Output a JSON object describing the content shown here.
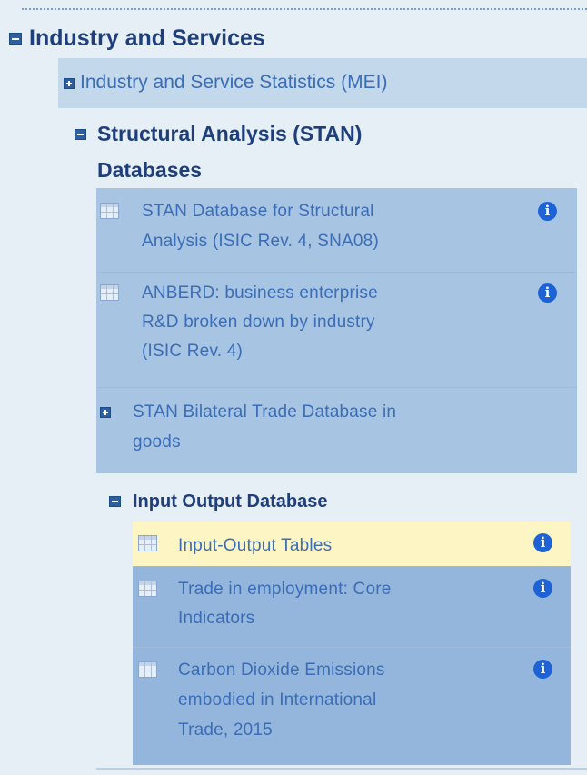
{
  "tree": {
    "root": {
      "label": "Industry and Services"
    },
    "mei": {
      "label": "Industry and Service Statistics (MEI)"
    },
    "stan": {
      "label_line1": "Structural Analysis (STAN)",
      "label_line2": "Databases",
      "items": [
        {
          "line1": "STAN Database for Structural",
          "line2": "Analysis (ISIC Rev. 4, SNA08)"
        },
        {
          "line1": "ANBERD: business enterprise",
          "line2": "R&D broken down by industry",
          "line3": "(ISIC Rev. 4)"
        }
      ],
      "bilateral": {
        "line1": "STAN Bilateral Trade Database in",
        "line2": "goods"
      }
    },
    "io": {
      "label": "Input Output Database",
      "items": [
        {
          "line1": "Input-Output Tables"
        },
        {
          "line1": "Trade in employment: Core",
          "line2": "Indicators"
        },
        {
          "line1": "Carbon Dioxide Emissions",
          "line2": "embodied in International",
          "line3": "Trade, 2015"
        }
      ]
    },
    "info_glyph": "i"
  },
  "colors": {
    "background": "#e6eef6",
    "mei_row": "#c4d8ec",
    "stan_block": "#a7c4e2",
    "io_block": "#94b6dc",
    "selected_row": "#fdf5c4",
    "heading_text": "#1f3e7c",
    "link_text": "#3a6db6",
    "info_icon": "#1d63d6"
  },
  "state": {
    "selected_item": "Input-Output Tables"
  }
}
